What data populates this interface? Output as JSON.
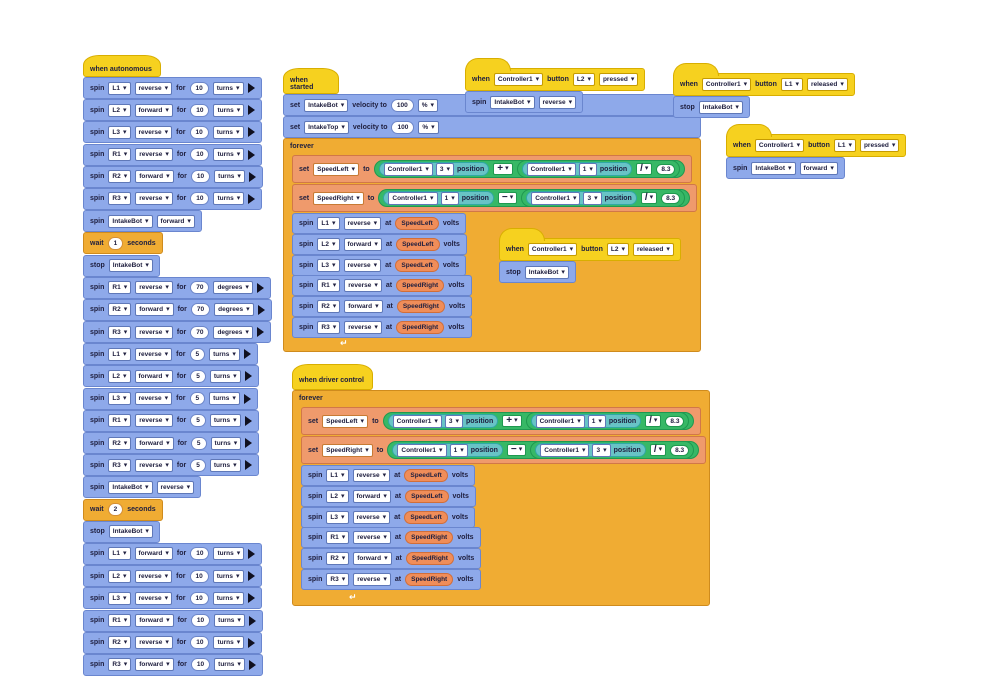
{
  "autonomous": {
    "hat_label": "when autonomous",
    "blocks": [
      {
        "kind": "spin",
        "label": "spin",
        "motor": "L1",
        "dir": "reverse",
        "for": "for",
        "amount": "10",
        "unit": "turns"
      },
      {
        "kind": "spin",
        "label": "spin",
        "motor": "L2",
        "dir": "forward",
        "for": "for",
        "amount": "10",
        "unit": "turns"
      },
      {
        "kind": "spin",
        "label": "spin",
        "motor": "L3",
        "dir": "reverse",
        "for": "for",
        "amount": "10",
        "unit": "turns"
      },
      {
        "kind": "spin",
        "label": "spin",
        "motor": "R1",
        "dir": "reverse",
        "for": "for",
        "amount": "10",
        "unit": "turns"
      },
      {
        "kind": "spin",
        "label": "spin",
        "motor": "R2",
        "dir": "forward",
        "for": "for",
        "amount": "10",
        "unit": "turns"
      },
      {
        "kind": "spin",
        "label": "spin",
        "motor": "R3",
        "dir": "reverse",
        "for": "for",
        "amount": "10",
        "unit": "turns"
      },
      {
        "kind": "spin2",
        "label": "spin",
        "motor": "IntakeBot",
        "dir": "forward"
      },
      {
        "kind": "wait",
        "label": "wait",
        "amount": "1",
        "unit": "seconds"
      },
      {
        "kind": "stop",
        "label": "stop",
        "motor": "IntakeBot"
      },
      {
        "kind": "spin",
        "label": "spin",
        "motor": "R1",
        "dir": "reverse",
        "for": "for",
        "amount": "70",
        "unit": "degrees"
      },
      {
        "kind": "spin",
        "label": "spin",
        "motor": "R2",
        "dir": "forward",
        "for": "for",
        "amount": "70",
        "unit": "degrees"
      },
      {
        "kind": "spin",
        "label": "spin",
        "motor": "R3",
        "dir": "reverse",
        "for": "for",
        "amount": "70",
        "unit": "degrees"
      },
      {
        "kind": "spin",
        "label": "spin",
        "motor": "L1",
        "dir": "reverse",
        "for": "for",
        "amount": "5",
        "unit": "turns"
      },
      {
        "kind": "spin",
        "label": "spin",
        "motor": "L2",
        "dir": "forward",
        "for": "for",
        "amount": "5",
        "unit": "turns"
      },
      {
        "kind": "spin",
        "label": "spin",
        "motor": "L3",
        "dir": "reverse",
        "for": "for",
        "amount": "5",
        "unit": "turns"
      },
      {
        "kind": "spin",
        "label": "spin",
        "motor": "R1",
        "dir": "reverse",
        "for": "for",
        "amount": "5",
        "unit": "turns"
      },
      {
        "kind": "spin",
        "label": "spin",
        "motor": "R2",
        "dir": "forward",
        "for": "for",
        "amount": "5",
        "unit": "turns"
      },
      {
        "kind": "spin",
        "label": "spin",
        "motor": "R3",
        "dir": "reverse",
        "for": "for",
        "amount": "5",
        "unit": "turns"
      },
      {
        "kind": "spin2",
        "label": "spin",
        "motor": "IntakeBot",
        "dir": "reverse"
      },
      {
        "kind": "wait",
        "label": "wait",
        "amount": "2",
        "unit": "seconds"
      },
      {
        "kind": "stop",
        "label": "stop",
        "motor": "IntakeBot"
      },
      {
        "kind": "spin",
        "label": "spin",
        "motor": "L1",
        "dir": "forward",
        "for": "for",
        "amount": "10",
        "unit": "turns"
      },
      {
        "kind": "spin",
        "label": "spin",
        "motor": "L2",
        "dir": "reverse",
        "for": "for",
        "amount": "10",
        "unit": "turns"
      },
      {
        "kind": "spin",
        "label": "spin",
        "motor": "L3",
        "dir": "reverse",
        "for": "for",
        "amount": "10",
        "unit": "turns"
      },
      {
        "kind": "spin",
        "label": "spin",
        "motor": "R1",
        "dir": "forward",
        "for": "for",
        "amount": "10",
        "unit": "turns"
      },
      {
        "kind": "spin",
        "label": "spin",
        "motor": "R2",
        "dir": "reverse",
        "for": "for",
        "amount": "10",
        "unit": "turns"
      },
      {
        "kind": "spin",
        "label": "spin",
        "motor": "R3",
        "dir": "forward",
        "for": "for",
        "amount": "10",
        "unit": "turns"
      }
    ]
  },
  "started": {
    "hat_label": "when started",
    "set1": {
      "label": "set",
      "motor": "IntakeBot",
      "mid": "velocity to",
      "value": "100",
      "unit": "%"
    },
    "set2": {
      "label": "set",
      "motor": "IntakeTop",
      "mid": "velocity to",
      "value": "100",
      "unit": "%"
    },
    "forever_label": "forever",
    "assign1": {
      "set": "set",
      "var": "SpeedLeft",
      "to": "to",
      "ctrl1": "Controller1",
      "axis1": "3",
      "pos1": "position",
      "op": "+",
      "ctrl2": "Controller1",
      "axis2": "1",
      "pos2": "position",
      "div": "/",
      "divisor": "8.3"
    },
    "assign2": {
      "set": "set",
      "var": "SpeedRight",
      "to": "to",
      "ctrl1": "Controller1",
      "axis1": "1",
      "pos1": "position",
      "op": "−",
      "ctrl2": "Controller1",
      "axis2": "3",
      "pos2": "position",
      "div": "/",
      "divisor": "8.3"
    },
    "spins": [
      {
        "label": "spin",
        "motor": "L1",
        "dir": "reverse",
        "at": "at",
        "var": "SpeedLeft",
        "unit": "volts"
      },
      {
        "label": "spin",
        "motor": "L2",
        "dir": "forward",
        "at": "at",
        "var": "SpeedLeft",
        "unit": "volts"
      },
      {
        "label": "spin",
        "motor": "L3",
        "dir": "reverse",
        "at": "at",
        "var": "SpeedLeft",
        "unit": "volts"
      },
      {
        "label": "spin",
        "motor": "R1",
        "dir": "reverse",
        "at": "at",
        "var": "SpeedRight",
        "unit": "volts"
      },
      {
        "label": "spin",
        "motor": "R2",
        "dir": "forward",
        "at": "at",
        "var": "SpeedRight",
        "unit": "volts"
      },
      {
        "label": "spin",
        "motor": "R3",
        "dir": "reverse",
        "at": "at",
        "var": "SpeedRight",
        "unit": "volts"
      }
    ]
  },
  "driver": {
    "hat_label": "when driver control",
    "forever_label": "forever",
    "assign1": {
      "set": "set",
      "var": "SpeedLeft",
      "to": "to",
      "ctrl1": "Controller1",
      "axis1": "3",
      "pos1": "position",
      "op": "+",
      "ctrl2": "Controller1",
      "axis2": "1",
      "pos2": "position",
      "div": "/",
      "divisor": "8.3"
    },
    "assign2": {
      "set": "set",
      "var": "SpeedRight",
      "to": "to",
      "ctrl1": "Controller1",
      "axis1": "1",
      "pos1": "position",
      "op": "−",
      "ctrl2": "Controller1",
      "axis2": "3",
      "pos2": "position",
      "div": "/",
      "divisor": "8.3"
    },
    "spins": [
      {
        "label": "spin",
        "motor": "L1",
        "dir": "reverse",
        "at": "at",
        "var": "SpeedLeft",
        "unit": "volts"
      },
      {
        "label": "spin",
        "motor": "L2",
        "dir": "forward",
        "at": "at",
        "var": "SpeedLeft",
        "unit": "volts"
      },
      {
        "label": "spin",
        "motor": "L3",
        "dir": "reverse",
        "at": "at",
        "var": "SpeedLeft",
        "unit": "volts"
      },
      {
        "label": "spin",
        "motor": "R1",
        "dir": "reverse",
        "at": "at",
        "var": "SpeedRight",
        "unit": "volts"
      },
      {
        "label": "spin",
        "motor": "R2",
        "dir": "forward",
        "at": "at",
        "var": "SpeedRight",
        "unit": "volts"
      },
      {
        "label": "spin",
        "motor": "R3",
        "dir": "reverse",
        "at": "at",
        "var": "SpeedRight",
        "unit": "volts"
      }
    ]
  },
  "events": [
    {
      "when": "when",
      "ctrl": "Controller1",
      "button_word": "button",
      "button": "L2",
      "state": "pressed",
      "action": "spin",
      "motor": "IntakeBot",
      "dir": "reverse"
    },
    {
      "when": "when",
      "ctrl": "Controller1",
      "button_word": "button",
      "button": "L1",
      "state": "released",
      "action": "stop",
      "motor": "IntakeBot",
      "dir": ""
    },
    {
      "when": "when",
      "ctrl": "Controller1",
      "button_word": "button",
      "button": "L1",
      "state": "pressed",
      "action": "spin",
      "motor": "IntakeBot",
      "dir": "forward"
    },
    {
      "when": "when",
      "ctrl": "Controller1",
      "button_word": "button",
      "button": "L2",
      "state": "released",
      "action": "stop",
      "motor": "IntakeBot",
      "dir": ""
    }
  ],
  "colors": {
    "motion": "#8ea9ea",
    "events": "#f6d11f",
    "control": "#f0ac33",
    "variables": "#ef9a6c",
    "operators": "#37b866",
    "sensing": "#68c3c6"
  }
}
